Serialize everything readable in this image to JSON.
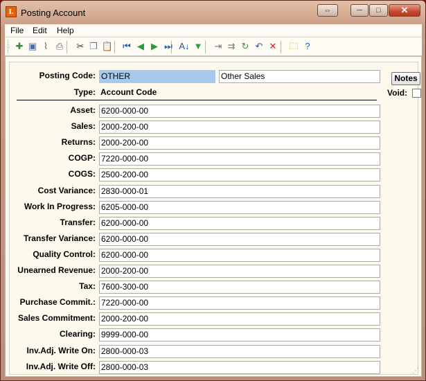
{
  "window": {
    "title": "Posting Account",
    "app_icon_text": "I.",
    "restore_glyph": "⇔",
    "minimize_glyph": "─",
    "maximize_glyph": "□",
    "close_glyph": "✕"
  },
  "menu": [
    "File",
    "Edit",
    "Help"
  ],
  "toolbar": [
    {
      "name": "new-record-icon",
      "glyph": "✚",
      "color": "#2f8f2f"
    },
    {
      "name": "save-icon",
      "glyph": "▣",
      "color": "#4a6aa8"
    },
    {
      "name": "attach-icon",
      "glyph": "⌇",
      "color": "#666666"
    },
    {
      "name": "print-icon",
      "glyph": "⎙",
      "color": "#666666"
    },
    {
      "name": "cut-icon",
      "glyph": "✂",
      "color": "#333333"
    },
    {
      "name": "copy-icon",
      "glyph": "❐",
      "color": "#5a7ab0"
    },
    {
      "name": "paste-icon",
      "glyph": "📋",
      "color": "#8a6a3a"
    },
    {
      "name": "first-record-icon",
      "glyph": "⏮",
      "color": "#1c5fb8"
    },
    {
      "name": "previous-record-icon",
      "glyph": "◀",
      "color": "#2e9b3a"
    },
    {
      "name": "next-record-icon",
      "glyph": "▶",
      "color": "#2e9b3a"
    },
    {
      "name": "last-record-icon",
      "glyph": "⏭",
      "color": "#1c5fb8"
    },
    {
      "name": "sort-az-icon",
      "glyph": "A↓",
      "color": "#2255aa"
    },
    {
      "name": "filter-icon",
      "glyph": "▼",
      "color": "#2e9b3a"
    },
    {
      "name": "insert-row-icon",
      "glyph": "⇥",
      "color": "#777777"
    },
    {
      "name": "append-row-icon",
      "glyph": "⇉",
      "color": "#777777"
    },
    {
      "name": "refresh-icon",
      "glyph": "↻",
      "color": "#2e9b3a"
    },
    {
      "name": "undo-icon",
      "glyph": "↶",
      "color": "#1c5fb8"
    },
    {
      "name": "delete-icon",
      "glyph": "✕",
      "color": "#d42020"
    },
    {
      "name": "open-folder-icon",
      "glyph": "🗀",
      "color": "#c8a020"
    },
    {
      "name": "help-icon",
      "glyph": "?",
      "color": "#1c5fb8"
    }
  ],
  "form": {
    "posting_code_label": "Posting Code:",
    "posting_code_value": "OTHER",
    "description_value": "Other Sales",
    "notes_label": "Notes",
    "type_label": "Type:",
    "type_value": "Account Code",
    "void_label": "Void:",
    "void_checked": false,
    "accounts": [
      {
        "label": "Asset:",
        "value": "6200-000-00"
      },
      {
        "label": "Sales:",
        "value": "2000-200-00"
      },
      {
        "label": "Returns:",
        "value": "2000-200-00"
      },
      {
        "label": "COGP:",
        "value": "7220-000-00"
      },
      {
        "label": "COGS:",
        "value": "2500-200-00"
      },
      {
        "label": "Cost Variance:",
        "value": "2830-000-01"
      },
      {
        "label": "Work In Progress:",
        "value": "6205-000-00"
      },
      {
        "label": "Transfer:",
        "value": "6200-000-00"
      },
      {
        "label": "Transfer Variance:",
        "value": "6200-000-00"
      },
      {
        "label": "Quality Control:",
        "value": "6200-000-00"
      },
      {
        "label": "Unearned Revenue:",
        "value": "2000-200-00"
      },
      {
        "label": "Tax:",
        "value": "7600-300-00"
      },
      {
        "label": "Purchase Commit.:",
        "value": "7220-000-00"
      },
      {
        "label": "Sales Commitment:",
        "value": "2000-200-00"
      },
      {
        "label": "Clearing:",
        "value": "9999-000-00"
      },
      {
        "label": "Inv.Adj. Write On:",
        "value": "2800-000-03"
      },
      {
        "label": "Inv.Adj. Write Off:",
        "value": "2800-000-03"
      }
    ]
  }
}
